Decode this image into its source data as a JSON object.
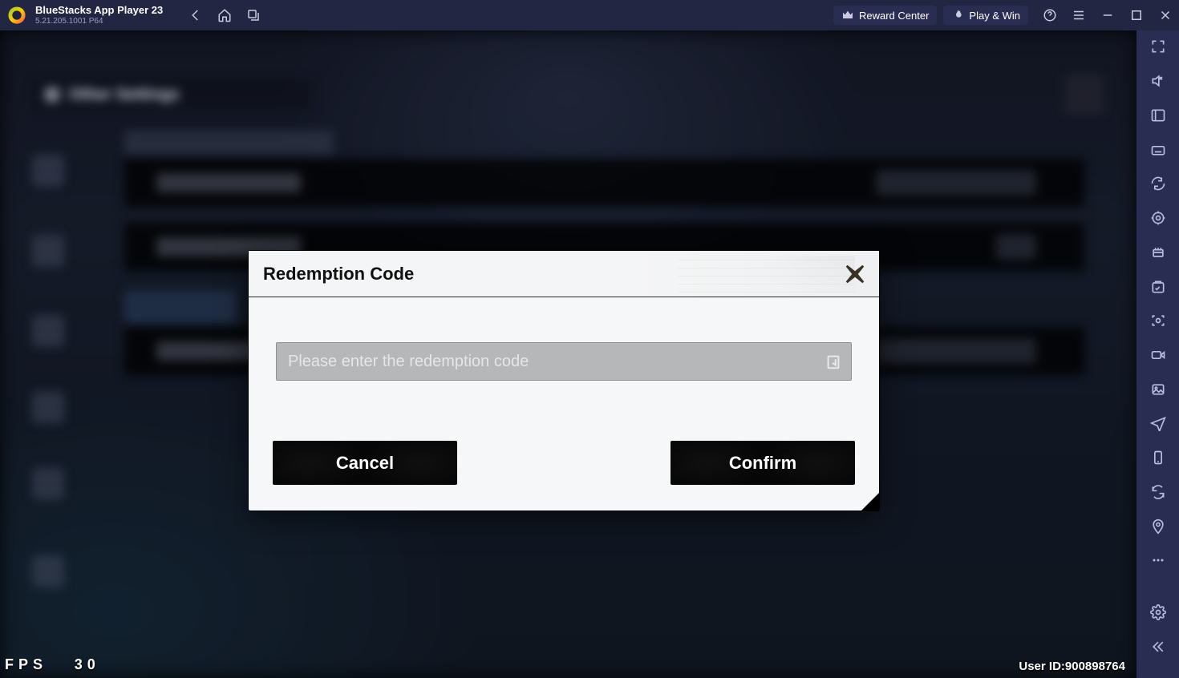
{
  "titlebar": {
    "title": "BlueStacks App Player 23",
    "subtitle": "5.21.205.1001  P64",
    "reward_center": "Reward Center",
    "play_win": "Play & Win"
  },
  "game_bg": {
    "settings_title": "Other Settings",
    "section_label": "System Function",
    "rows": [
      {
        "label": "Log Upload",
        "action": "Go"
      },
      {
        "label": "Notification",
        "action": ""
      },
      {
        "label": "Account",
        "action": ""
      },
      {
        "label": "Redemption",
        "action": ""
      }
    ]
  },
  "modal": {
    "title": "Redemption Code",
    "placeholder": "Please enter the redemption code",
    "cancel": "Cancel",
    "confirm": "Confirm"
  },
  "footer": {
    "fps_label": "FPS",
    "fps_value": "30",
    "user_id_label": "User ID:",
    "user_id_value": "900898764"
  }
}
